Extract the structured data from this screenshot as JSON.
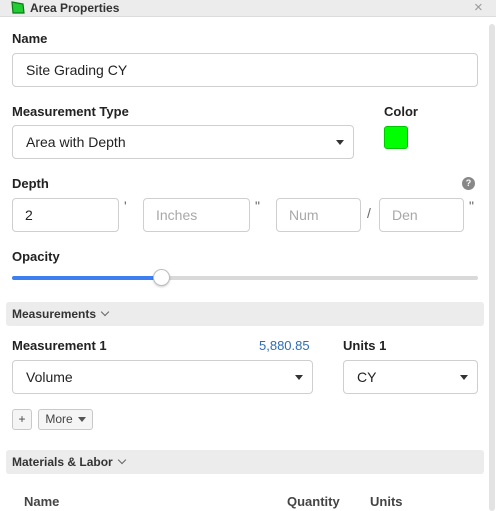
{
  "window": {
    "title": "Area Properties",
    "close_glyph": "×",
    "icon": "area-polygon-icon"
  },
  "name_field": {
    "label": "Name",
    "value": "Site Grading CY"
  },
  "measurement_type": {
    "label": "Measurement Type",
    "value": "Area with Depth"
  },
  "color": {
    "label": "Color",
    "value": "#00ff00"
  },
  "depth": {
    "label": "Depth",
    "help_glyph": "?",
    "feet_value": "2",
    "feet_mark": "'",
    "inches_placeholder": "Inches",
    "inches_mark": "\"",
    "num_placeholder": "Num",
    "fraction_mark": "/",
    "den_placeholder": "Den",
    "den_mark": "\""
  },
  "opacity": {
    "label": "Opacity",
    "level": 0.32
  },
  "measurements": {
    "header": "Measurements",
    "measurement_label": "Measurement 1",
    "measurement_value": "5,880.85",
    "measurement_select": "Volume",
    "units_label": "Units 1",
    "units_select": "CY",
    "add_label": "+",
    "more_label": "More"
  },
  "materials": {
    "header": "Materials & Labor",
    "columns": [
      "Name",
      "Quantity",
      "Units"
    ]
  },
  "colors": {
    "accent": "#3d7ff0",
    "link": "#2f6db5",
    "swatch": "#00ff00"
  }
}
